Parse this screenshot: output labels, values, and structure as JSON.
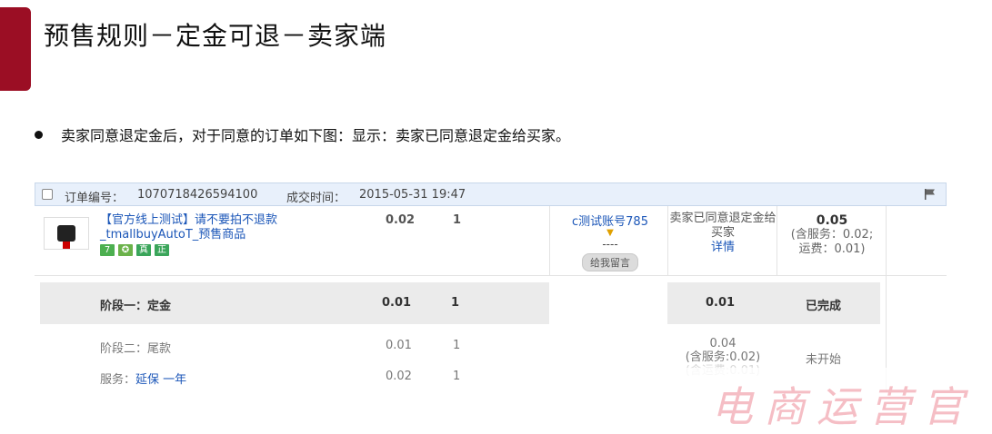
{
  "slide": {
    "title": "预售规则－定金可退－卖家端",
    "bullet": "卖家同意退定金后，对于同意的订单如下图：显示：卖家已同意退定金给买家。"
  },
  "order": {
    "order_no_label": "订单编号：",
    "order_no": "1070718426594100",
    "deal_time_label": "成交时间：",
    "deal_time": "2015-05-31 19:47",
    "item": {
      "title": "【官方线上测试】请不要拍不退款_tmallbuyAutoT_预售商品",
      "badges": [
        {
          "text": "7",
          "color": "#4caf50"
        },
        {
          "text": "✪",
          "color": "#6bb24a"
        },
        {
          "text": "真",
          "color": "#3aa55a"
        },
        {
          "text": "正",
          "color": "#3aa55a"
        }
      ],
      "price": "0.02",
      "qty": "1"
    },
    "buyer": {
      "name": "c测试账号785",
      "dashes": "----",
      "message_button": "给我留言"
    },
    "status": {
      "text": "卖家已同意退定金给买家",
      "details_link": "详情"
    },
    "total": {
      "amount": "0.05",
      "service_note": "(含服务：0.02;",
      "shipping_note": "运费：0.01)"
    },
    "stage1": {
      "label": "阶段一：定金",
      "price": "0.01",
      "qty": "1",
      "amount": "0.01",
      "status": "已完成"
    },
    "stage2": {
      "label": "阶段二：尾款",
      "price": "0.01",
      "qty": "1",
      "amount": "0.04",
      "service_note": "(含服务:0.02)",
      "faded_note": "(含运费:0.01)",
      "status": "未开始"
    },
    "service_row": {
      "label": "服务：",
      "service_name": "延保 一年",
      "price": "0.02",
      "qty": "1"
    }
  },
  "watermark": {
    "text": "电商运营官"
  },
  "colors": {
    "accent": "#9b0e24",
    "link": "#1b56b8",
    "header_bg": "#e8f0fb"
  }
}
